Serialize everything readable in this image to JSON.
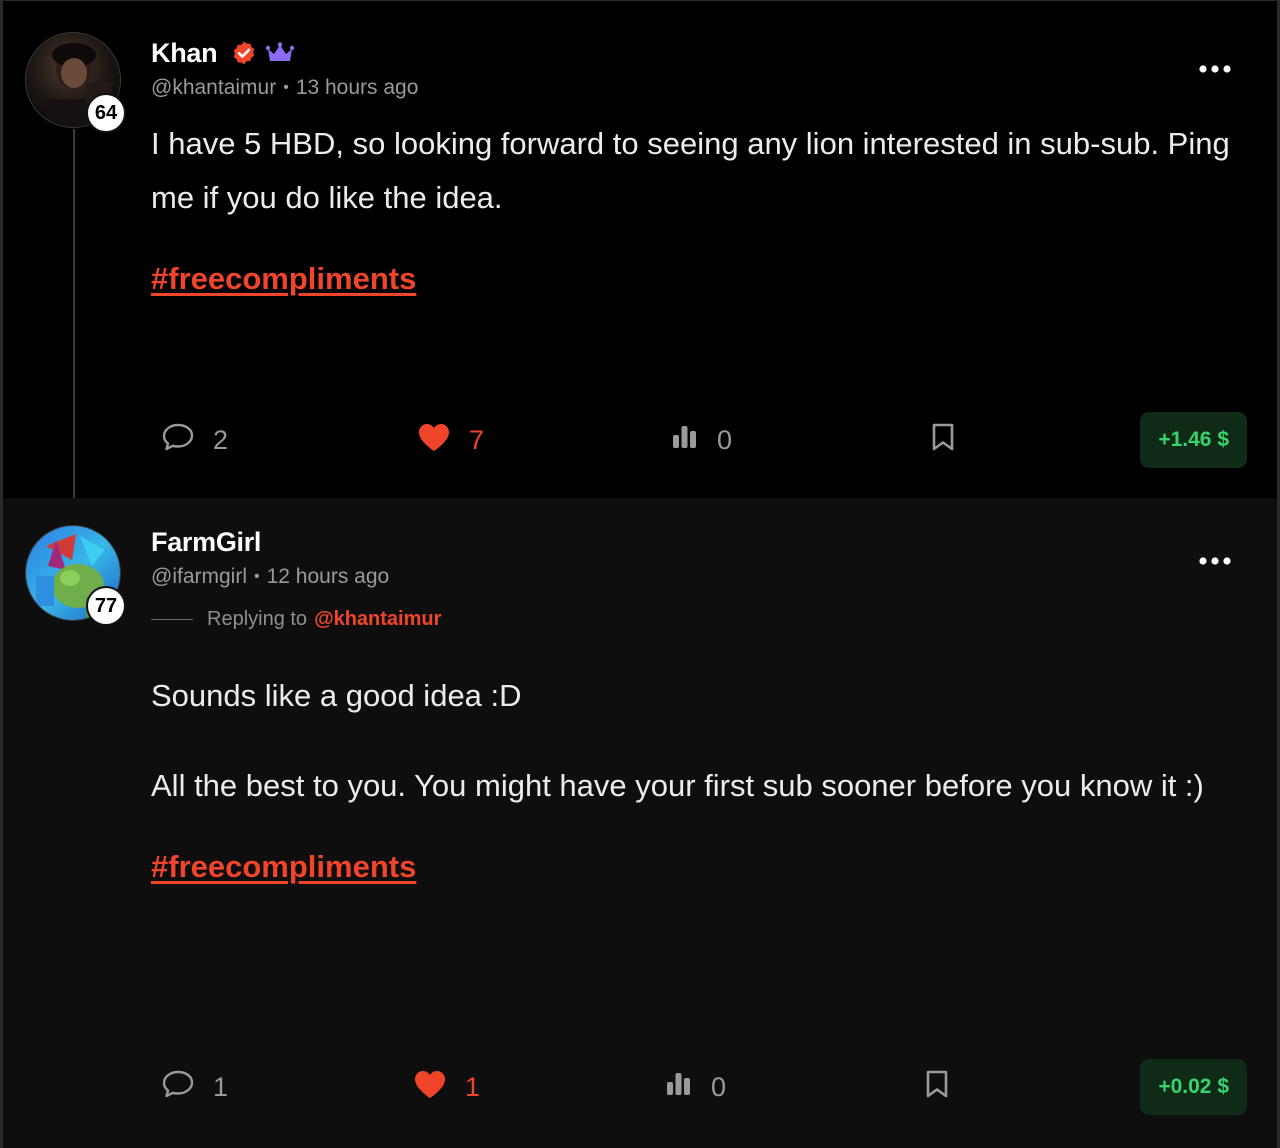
{
  "colors": {
    "accent": "#f0452b",
    "payout_bg": "#0f2a17",
    "payout_text": "#36d46b",
    "muted": "#9a9a9a",
    "crown": "#8b6cf0"
  },
  "posts": [
    {
      "display_name": "Khan",
      "handle": "@khantaimur",
      "time": "13 hours ago",
      "reputation": "64",
      "verified_icon": "verified-check-icon",
      "crown_icon": "crown-icon",
      "body": [
        "I have 5 HBD, so looking forward to seeing any lion interested in sub-sub. Ping me if you do like the idea."
      ],
      "hashtag": "#freecompliments",
      "comments": "2",
      "likes": "7",
      "views": "0",
      "payout": "+1.46 $"
    },
    {
      "display_name": "FarmGirl",
      "handle": "@ifarmgirl",
      "time": "12 hours ago",
      "reputation": "77",
      "replying_to_label": "Replying to",
      "replying_to_user": "@khantaimur",
      "body": [
        "Sounds like a good idea :D",
        "All the best to you. You might have your first sub sooner before you know it :)"
      ],
      "hashtag": "#freecompliments",
      "comments": "1",
      "likes": "1",
      "views": "0",
      "payout": "+0.02 $"
    }
  ]
}
